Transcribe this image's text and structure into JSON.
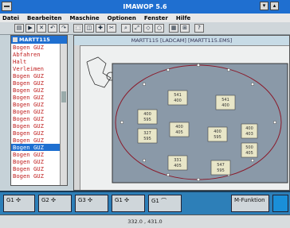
{
  "window": {
    "title": "IMAWOP 5.6"
  },
  "menu": [
    "Datei",
    "Bearbeiten",
    "Maschine",
    "Optionen",
    "Fenster",
    "Hilfe"
  ],
  "toolbar": [
    "▤",
    "▶",
    "✕",
    "↶",
    "↷",
    "⬚",
    "◫",
    "✚",
    "✂",
    "⌕",
    "⤢",
    "◇",
    "○",
    "▦",
    "⊞",
    "?"
  ],
  "program_list": {
    "title": "MARTT115",
    "items": [
      "Bogen GUZ",
      "Abfahren",
      "Halt",
      "Verleimen",
      "Bogen GUZ",
      "Bogen GUZ",
      "Bogen GUZ",
      "Bogen GUZ",
      "Bogen GUZ",
      "Bogen GUZ",
      "Bogen GUZ",
      "Bogen GUZ",
      "Bogen GUZ",
      "Bogen GUZ",
      "Bogen GUZ",
      "Bogen GUZ",
      "Bogen GUZ",
      "Bogen GUZ",
      "Bogen GUZ"
    ],
    "selected_index": 14
  },
  "main_window": {
    "title": "MARTT115 [LADCAM] [MARTT115.EMS]",
    "boxes": [
      {
        "a": "541",
        "b": "400"
      },
      {
        "a": "541",
        "b": "400"
      },
      {
        "a": "400",
        "b": "595"
      },
      {
        "a": "327",
        "b": "595"
      },
      {
        "a": "400",
        "b": "405"
      },
      {
        "a": "400",
        "b": "595"
      },
      {
        "a": "400",
        "b": "403"
      },
      {
        "a": "500",
        "b": "405"
      },
      {
        "a": "331",
        "b": "405"
      },
      {
        "a": "547",
        "b": "595"
      }
    ]
  },
  "function_bar": {
    "buttons": [
      "G1",
      "G2",
      "G3",
      "G1",
      "G1",
      "M-Funktion"
    ]
  },
  "status": {
    "coords": "332.0 , 431.0"
  },
  "colors": {
    "titlebar": "#1f6fd0",
    "list_text": "#c02020",
    "function_bar": "#2d7fb8"
  }
}
